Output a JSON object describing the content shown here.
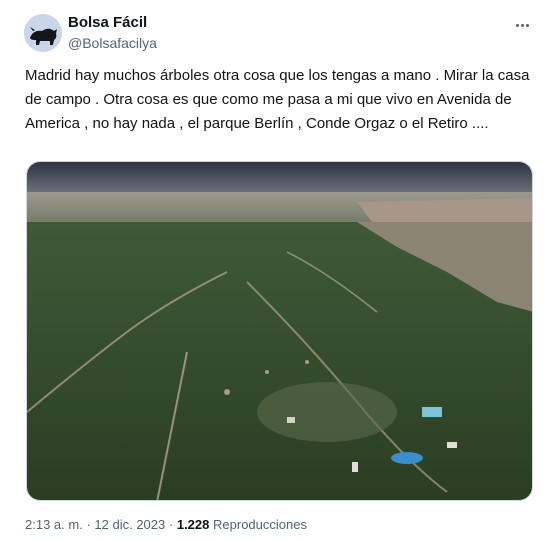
{
  "author": {
    "display_name": "Bolsa Fácil",
    "handle": "@Bolsafacilya"
  },
  "tweet": {
    "text": "Madrid hay muchos árboles otra cosa que los tengas a mano . Mirar la casa de campo . Otra cosa es que como me pasa a mi que vivo en Avenida de America , no hay nada , el parque Berlín , Conde Orgaz o el Retiro ...."
  },
  "meta": {
    "time": "2:13 a. m.",
    "separator1": "·",
    "date": "12 dic. 2023",
    "separator2": "·",
    "views_count": "1.228",
    "views_label": "Reproducciones"
  },
  "icons": {
    "more": "more-dots-icon"
  },
  "colors": {
    "text_primary": "#0f1419",
    "text_secondary": "#536471",
    "border": "#cfd9de"
  }
}
